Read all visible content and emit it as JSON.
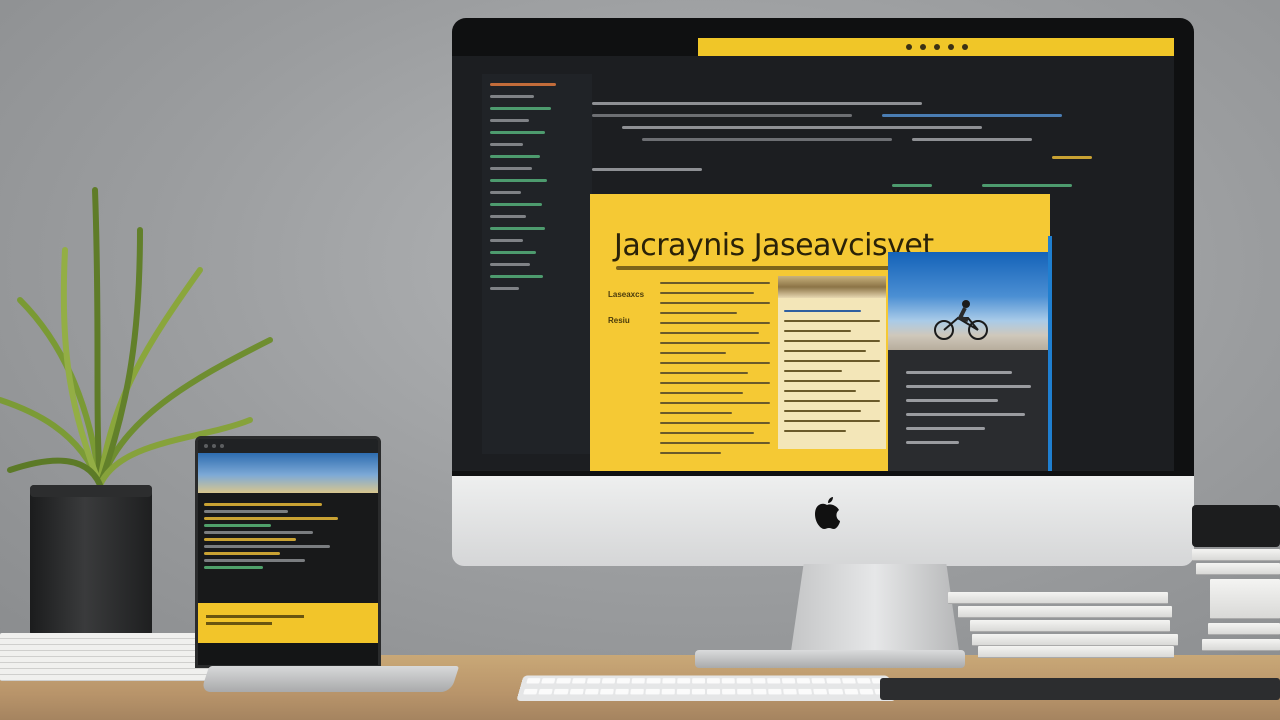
{
  "scene": {
    "description_free": true
  },
  "monitor": {
    "browser_url": "",
    "page": {
      "title": "Jacraynis Jaseavcisvet",
      "side_labels": [
        "Laseaxcs",
        "Resiu"
      ]
    }
  },
  "colors": {
    "accent_yellow": "#f5c934",
    "editor_bg": "#202327",
    "photo_sky": "#1462b8"
  }
}
